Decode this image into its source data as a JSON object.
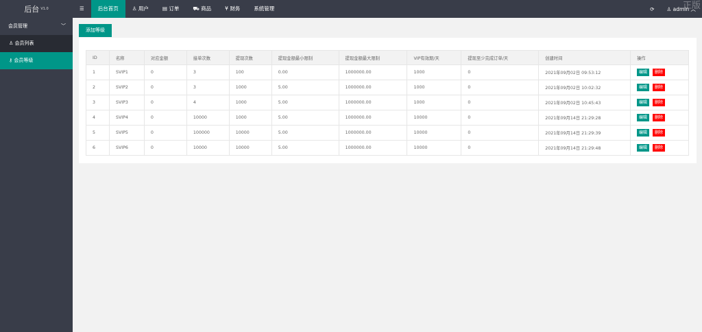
{
  "header": {
    "logo": "后台",
    "version": "V1.0",
    "menu_icon": "hamburger-icon",
    "nav": [
      {
        "label": "后台首页",
        "icon": ""
      },
      {
        "label": "用户",
        "icon": "user-icon"
      },
      {
        "label": "订单",
        "icon": "document-icon"
      },
      {
        "label": "商品",
        "icon": "cart-icon"
      },
      {
        "label": "财务",
        "icon": "yen-icon"
      },
      {
        "label": "系统管理",
        "icon": ""
      }
    ],
    "user": "admin",
    "watermark": "正版"
  },
  "sidebar": {
    "group": "会员管理",
    "items": [
      {
        "label": "会员列表",
        "icon": "user-icon"
      },
      {
        "label": "会员等级",
        "icon": "key-icon",
        "active": true
      }
    ]
  },
  "main": {
    "add_button": "添加等级",
    "table": {
      "columns": [
        "ID",
        "名称",
        "对应金额",
        "接单次数",
        "提现次数",
        "提现金额最小限制",
        "提现金额最大限制",
        "VIP有效期/天",
        "提现至少完成订单/天",
        "创建时间",
        "操作"
      ],
      "rows": [
        [
          "1",
          "SVIP1",
          "0",
          "3",
          "100",
          "0.00",
          "1000000.00",
          "1000",
          "0",
          "2021年09月02日 09:53:12"
        ],
        [
          "2",
          "SVIP2",
          "0",
          "3",
          "1000",
          "5.00",
          "1000000.00",
          "1000",
          "0",
          "2021年09月02日 10:02:32"
        ],
        [
          "3",
          "SVIP3",
          "0",
          "4",
          "1000",
          "5.00",
          "1000000.00",
          "1000",
          "0",
          "2021年09月02日 10:45:43"
        ],
        [
          "4",
          "SVIP4",
          "0",
          "10000",
          "1000",
          "5.00",
          "1000000.00",
          "10000",
          "0",
          "2021年09月14日 21:29:28"
        ],
        [
          "5",
          "SVIP5",
          "0",
          "100000",
          "10000",
          "5.00",
          "1000000.00",
          "10000",
          "0",
          "2021年09月14日 21:29:39"
        ],
        [
          "6",
          "SVIP6",
          "0",
          "10000",
          "10000",
          "5.00",
          "1000000.00",
          "10000",
          "0",
          "2021年09月14日 21:29:48"
        ]
      ],
      "edit_label": "编辑",
      "delete_label": "删除"
    }
  },
  "colors": {
    "accent": "#009688",
    "danger": "#ff0000",
    "topbar": "#393d49"
  }
}
